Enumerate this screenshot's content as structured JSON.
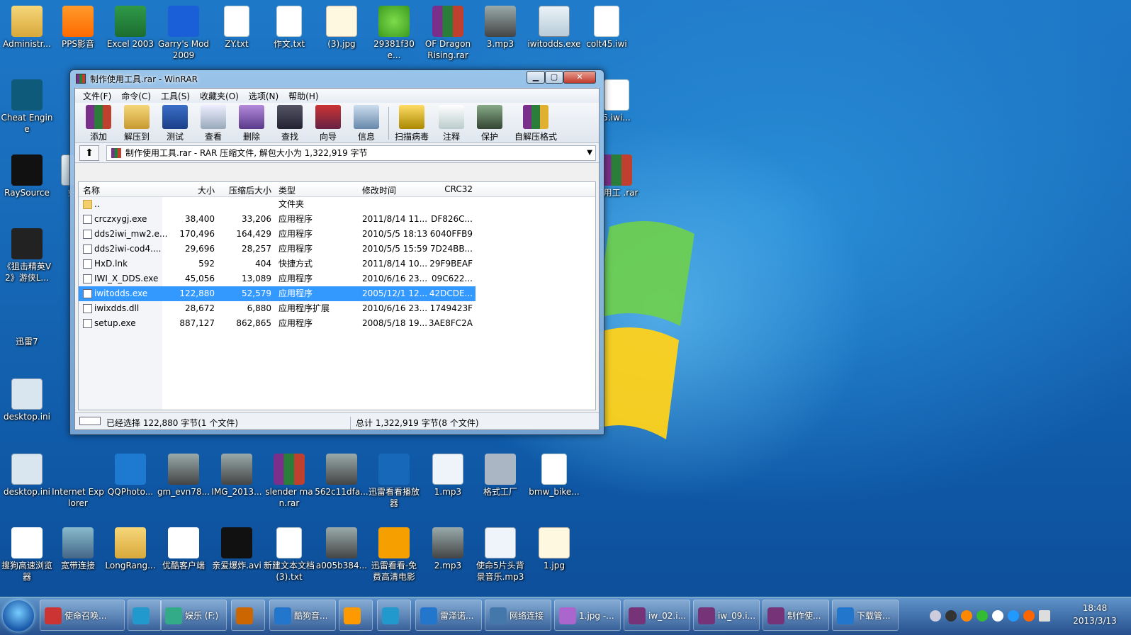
{
  "desktop": {
    "icons": [
      {
        "label": "Administr..."
      },
      {
        "label": "PPS影音"
      },
      {
        "label": "Excel 2003"
      },
      {
        "label": "Garry's Mod 2009"
      },
      {
        "label": "ZY.txt"
      },
      {
        "label": "作文.txt"
      },
      {
        "label": "(3).jpg"
      },
      {
        "label": "29381f30e..."
      },
      {
        "label": "OF Dragon Rising.rar"
      },
      {
        "label": "3.mp3"
      },
      {
        "label": "iwitodds.exe"
      },
      {
        "label": "colt45.iwi"
      },
      {
        "label": "Cheat Engine"
      },
      {
        "label": "RaySource"
      },
      {
        "label": "《狙击精英V2》游侠L..."
      },
      {
        "label": "迅雷7"
      },
      {
        "label": "desktop.ini"
      },
      {
        "label": "desktop.ini"
      },
      {
        "label": "Internet Explorer"
      },
      {
        "label": "QQPhoto..."
      },
      {
        "label": "gm_evn78..."
      },
      {
        "label": "IMG_2013..."
      },
      {
        "label": "slender man.rar"
      },
      {
        "label": "562c11dfa..."
      },
      {
        "label": "迅雷看看播放器"
      },
      {
        "label": "1.mp3"
      },
      {
        "label": "格式工厂"
      },
      {
        "label": "bmw_bike..."
      },
      {
        "label": "搜狗高速浏览器"
      },
      {
        "label": "宽带连接"
      },
      {
        "label": "LongRang..."
      },
      {
        "label": "优酷客户端"
      },
      {
        "label": "亲爱爆炸.avi"
      },
      {
        "label": "新建文本文档 (3).txt"
      },
      {
        "label": "a005b384..."
      },
      {
        "label": "迅雷看看-免费高清电影"
      },
      {
        "label": "2.mp3"
      },
      {
        "label": "使命5片头背景音乐.mp3"
      },
      {
        "label": "1.jpg"
      },
      {
        "label": "好桌"
      },
      {
        "label": "5.iwi..."
      },
      {
        "label": "使用工 .rar"
      }
    ]
  },
  "winrar": {
    "title": "制作使用工具.rar - WinRAR",
    "menu": [
      "文件(F)",
      "命令(C)",
      "工具(S)",
      "收藏夹(O)",
      "选项(N)",
      "帮助(H)"
    ],
    "toolbar": [
      "添加",
      "解压到",
      "测试",
      "查看",
      "删除",
      "查找",
      "向导",
      "信息",
      "扫描病毒",
      "注释",
      "保护",
      "自解压格式"
    ],
    "address": "制作使用工具.rar - RAR 压缩文件, 解包大小为 1,322,919 字节",
    "columns": [
      "名称",
      "大小",
      "压缩后大小",
      "类型",
      "修改时间",
      "CRC32"
    ],
    "files": [
      {
        "name": "..",
        "size": "",
        "packed": "",
        "type": "文件夹",
        "modified": "",
        "crc": ""
      },
      {
        "name": "crczxygj.exe",
        "size": "38,400",
        "packed": "33,206",
        "type": "应用程序",
        "modified": "2011/8/14 11...",
        "crc": "DF826C..."
      },
      {
        "name": "dds2iwi_mw2.e...",
        "size": "170,496",
        "packed": "164,429",
        "type": "应用程序",
        "modified": "2010/5/5 18:13",
        "crc": "6040FFB9"
      },
      {
        "name": "dds2iwi-cod4....",
        "size": "29,696",
        "packed": "28,257",
        "type": "应用程序",
        "modified": "2010/5/5 15:59",
        "crc": "7D24BB..."
      },
      {
        "name": "HxD.lnk",
        "size": "592",
        "packed": "404",
        "type": "快捷方式",
        "modified": "2011/8/14 10...",
        "crc": "29F9BEAF"
      },
      {
        "name": "IWI_X_DDS.exe",
        "size": "45,056",
        "packed": "13,089",
        "type": "应用程序",
        "modified": "2010/6/16 23...",
        "crc": "09C622..."
      },
      {
        "name": "iwitodds.exe",
        "size": "122,880",
        "packed": "52,579",
        "type": "应用程序",
        "modified": "2005/12/1 12...",
        "crc": "42DCDE..."
      },
      {
        "name": "iwixdds.dll",
        "size": "28,672",
        "packed": "6,880",
        "type": "应用程序扩展",
        "modified": "2010/6/16 23...",
        "crc": "1749423F"
      },
      {
        "name": "setup.exe",
        "size": "887,127",
        "packed": "862,865",
        "type": "应用程序",
        "modified": "2008/5/18 19...",
        "crc": "3AE8FC2A"
      }
    ],
    "selected_index": 6,
    "status_left": "已经选择 122,880 字节(1 个文件)",
    "status_right": "总计 1,322,919 字节(8 个文件)"
  },
  "taskbar": {
    "buttons": [
      {
        "label": "使命召唤..."
      },
      {
        "label": ""
      },
      {
        "label": "娱乐 (F:)"
      },
      {
        "label": ""
      },
      {
        "label": "酷狗音..."
      },
      {
        "label": ""
      },
      {
        "label": ""
      },
      {
        "label": "雷泽诺..."
      },
      {
        "label": "网络连接"
      },
      {
        "label": "1.jpg -..."
      },
      {
        "label": "iw_02.i..."
      },
      {
        "label": "iw_09.i..."
      },
      {
        "label": "制作使..."
      },
      {
        "label": "下载管..."
      }
    ],
    "clock_time": "18:48",
    "clock_date": "2013/3/13"
  }
}
